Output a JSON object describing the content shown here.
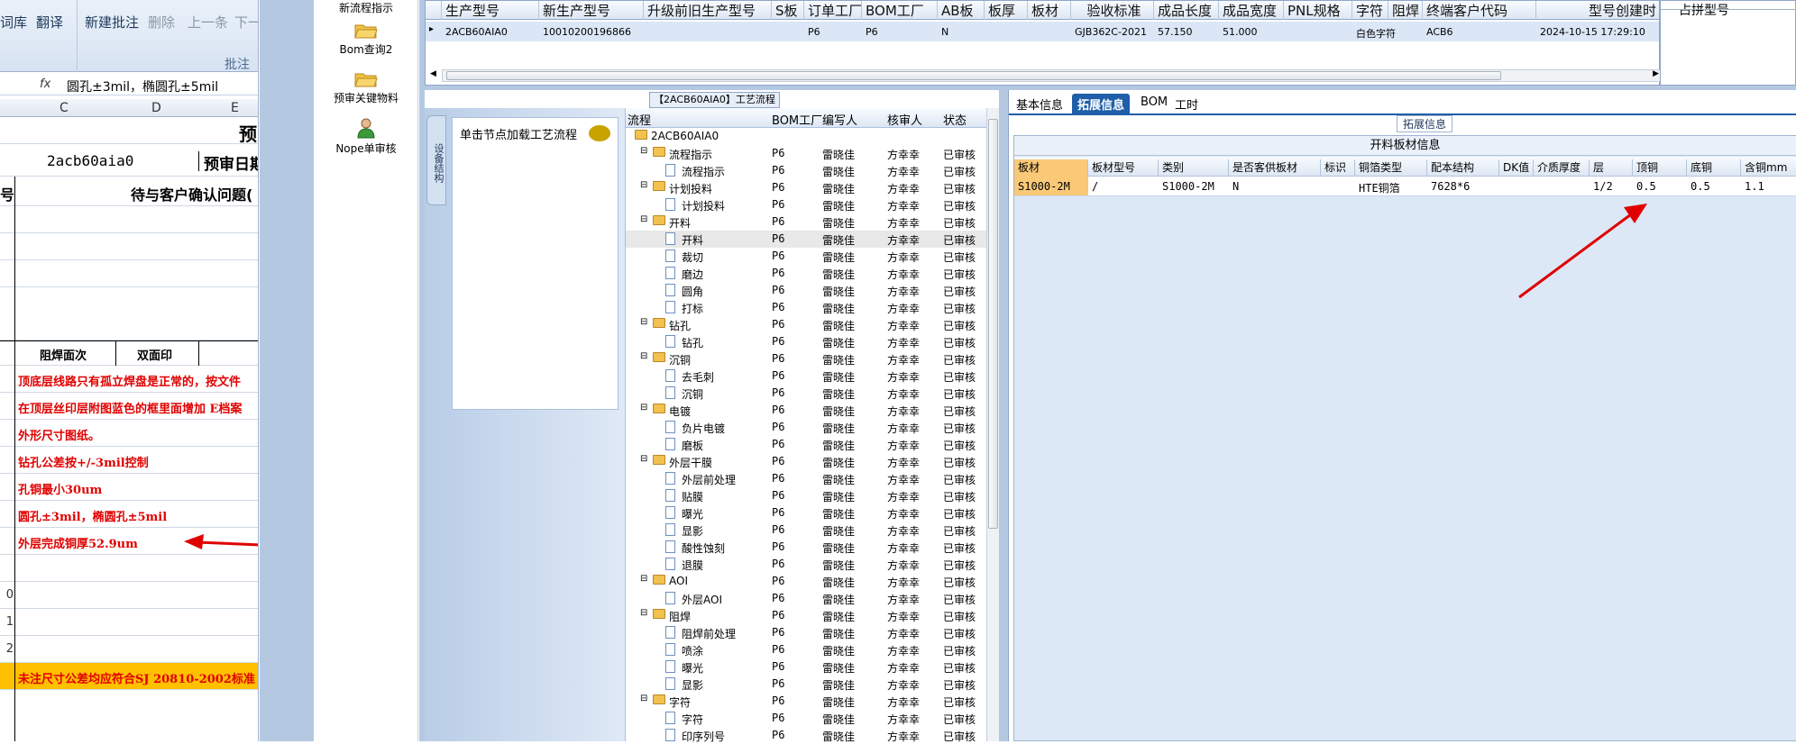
{
  "excel": {
    "ribbon": {
      "partial_label": "词库",
      "translate": "翻译",
      "new_annotation": "新建批注",
      "delete": "删除",
      "prev": "上一条",
      "next": "下一",
      "group_title": "批注"
    },
    "formula_value": "圆孔±3mil，椭圆孔±5mil",
    "columns": [
      "C",
      "D",
      "E"
    ],
    "partial_title_char": "预",
    "model_value": "2acb60aia0",
    "review_date_label": "预审日期",
    "pending_header": "待与客户确认问题(",
    "partial_num_header": "号",
    "solder_mask_side": "阻焊面次",
    "double_print": "双面印",
    "rows": [
      {
        "num": "",
        "text": "顶底层线路只有孤立焊盘是正常的，按文件"
      },
      {
        "num": "",
        "text": "在顶层丝印层附图蓝色的框里面增加 E档案"
      },
      {
        "num": "",
        "text": "外形尺寸图纸。"
      },
      {
        "num": "",
        "text": "钻孔公差按+/-3mil控制"
      },
      {
        "num": "",
        "text": "孔铜最小30um"
      },
      {
        "num": "",
        "text": "圆孔±3mil，椭圆孔±5mil"
      },
      {
        "num": "",
        "text": "外层完成铜厚52.9um"
      },
      {
        "num": "",
        "text": ""
      },
      {
        "num": "0",
        "text": ""
      },
      {
        "num": "1",
        "text": ""
      },
      {
        "num": "2",
        "text": ""
      },
      {
        "num": "",
        "text": "未注尺寸公差均应符合SJ 20810-2002标准"
      }
    ]
  },
  "launcher": {
    "items": [
      {
        "label": "新流程指示"
      },
      {
        "label": "Bom查询2"
      },
      {
        "label": "预审关键物料"
      },
      {
        "label": "Nope单审核"
      }
    ]
  },
  "top_grid": {
    "headers": [
      "生产型号",
      "新生产型号",
      "升级前旧生产型号",
      "S板",
      "订单工厂",
      "BOM工厂",
      "AB板",
      "板厚",
      "板材",
      "验收标准",
      "成品长度",
      "成品宽度",
      "PNL规格",
      "字符",
      "阻焊",
      "终端客户代码",
      "型号创建时"
    ],
    "row": [
      "2ACB60AIA0",
      "10010200196866",
      "",
      "",
      "P6",
      "P6",
      "N",
      "",
      "",
      "GJB362C-2021",
      "57.150",
      "51.000",
      "",
      "白色字符",
      "",
      "ACB6",
      "2024-10-15 17:29:10"
    ],
    "right_header": "占拼型号"
  },
  "process": {
    "title": "【2ACB60AIA0】工艺流程",
    "vtab_label": "设备结构",
    "hint": "单击节点加载工艺流程",
    "headers": [
      "流程",
      "BOM工厂",
      "编写人",
      "核审人",
      "状态"
    ],
    "nodes": [
      {
        "level": 0,
        "name": "2ACB60AIA0",
        "factory": "",
        "writer": "",
        "reviewer": "",
        "status": ""
      },
      {
        "level": 1,
        "name": "流程指示",
        "factory": "P6",
        "writer": "雷晓佳",
        "reviewer": "方幸幸",
        "status": "已审核"
      },
      {
        "level": 2,
        "name": "流程指示",
        "factory": "P6",
        "writer": "雷晓佳",
        "reviewer": "方幸幸",
        "status": "已审核"
      },
      {
        "level": 1,
        "name": "计划投料",
        "factory": "P6",
        "writer": "雷晓佳",
        "reviewer": "方幸幸",
        "status": "已审核"
      },
      {
        "level": 2,
        "name": "计划投料",
        "factory": "P6",
        "writer": "雷晓佳",
        "reviewer": "方幸幸",
        "status": "已审核"
      },
      {
        "level": 1,
        "name": "开料",
        "factory": "P6",
        "writer": "雷晓佳",
        "reviewer": "方幸幸",
        "status": "已审核"
      },
      {
        "level": 2,
        "name": "开料",
        "factory": "P6",
        "writer": "雷晓佳",
        "reviewer": "方幸幸",
        "status": "已审核"
      },
      {
        "level": 2,
        "name": "裁切",
        "factory": "P6",
        "writer": "雷晓佳",
        "reviewer": "方幸幸",
        "status": "已审核"
      },
      {
        "level": 2,
        "name": "磨边",
        "factory": "P6",
        "writer": "雷晓佳",
        "reviewer": "方幸幸",
        "status": "已审核"
      },
      {
        "level": 2,
        "name": "圆角",
        "factory": "P6",
        "writer": "雷晓佳",
        "reviewer": "方幸幸",
        "status": "已审核"
      },
      {
        "level": 2,
        "name": "打标",
        "factory": "P6",
        "writer": "雷晓佳",
        "reviewer": "方幸幸",
        "status": "已审核"
      },
      {
        "level": 1,
        "name": "钻孔",
        "factory": "P6",
        "writer": "雷晓佳",
        "reviewer": "方幸幸",
        "status": "已审核"
      },
      {
        "level": 2,
        "name": "钻孔",
        "factory": "P6",
        "writer": "雷晓佳",
        "reviewer": "方幸幸",
        "status": "已审核"
      },
      {
        "level": 1,
        "name": "沉铜",
        "factory": "P6",
        "writer": "雷晓佳",
        "reviewer": "方幸幸",
        "status": "已审核"
      },
      {
        "level": 2,
        "name": "去毛刺",
        "factory": "P6",
        "writer": "雷晓佳",
        "reviewer": "方幸幸",
        "status": "已审核"
      },
      {
        "level": 2,
        "name": "沉铜",
        "factory": "P6",
        "writer": "雷晓佳",
        "reviewer": "方幸幸",
        "status": "已审核"
      },
      {
        "level": 1,
        "name": "电镀",
        "factory": "P6",
        "writer": "雷晓佳",
        "reviewer": "方幸幸",
        "status": "已审核"
      },
      {
        "level": 2,
        "name": "负片电镀",
        "factory": "P6",
        "writer": "雷晓佳",
        "reviewer": "方幸幸",
        "status": "已审核"
      },
      {
        "level": 2,
        "name": "磨板",
        "factory": "P6",
        "writer": "雷晓佳",
        "reviewer": "方幸幸",
        "status": "已审核"
      },
      {
        "level": 1,
        "name": "外层干膜",
        "factory": "P6",
        "writer": "雷晓佳",
        "reviewer": "方幸幸",
        "status": "已审核"
      },
      {
        "level": 2,
        "name": "外层前处理",
        "factory": "P6",
        "writer": "雷晓佳",
        "reviewer": "方幸幸",
        "status": "已审核"
      },
      {
        "level": 2,
        "name": "贴膜",
        "factory": "P6",
        "writer": "雷晓佳",
        "reviewer": "方幸幸",
        "status": "已审核"
      },
      {
        "level": 2,
        "name": "曝光",
        "factory": "P6",
        "writer": "雷晓佳",
        "reviewer": "方幸幸",
        "status": "已审核"
      },
      {
        "level": 2,
        "name": "显影",
        "factory": "P6",
        "writer": "雷晓佳",
        "reviewer": "方幸幸",
        "status": "已审核"
      },
      {
        "level": 2,
        "name": "酸性蚀刻",
        "factory": "P6",
        "writer": "雷晓佳",
        "reviewer": "方幸幸",
        "status": "已审核"
      },
      {
        "level": 2,
        "name": "退膜",
        "factory": "P6",
        "writer": "雷晓佳",
        "reviewer": "方幸幸",
        "status": "已审核"
      },
      {
        "level": 1,
        "name": "AOI",
        "factory": "P6",
        "writer": "雷晓佳",
        "reviewer": "方幸幸",
        "status": "已审核"
      },
      {
        "level": 2,
        "name": "外层AOI",
        "factory": "P6",
        "writer": "雷晓佳",
        "reviewer": "方幸幸",
        "status": "已审核"
      },
      {
        "level": 1,
        "name": "阻焊",
        "factory": "P6",
        "writer": "雷晓佳",
        "reviewer": "方幸幸",
        "status": "已审核"
      },
      {
        "level": 2,
        "name": "阻焊前处理",
        "factory": "P6",
        "writer": "雷晓佳",
        "reviewer": "方幸幸",
        "status": "已审核"
      },
      {
        "level": 2,
        "name": "喷涂",
        "factory": "P6",
        "writer": "雷晓佳",
        "reviewer": "方幸幸",
        "status": "已审核"
      },
      {
        "level": 2,
        "name": "曝光",
        "factory": "P6",
        "writer": "雷晓佳",
        "reviewer": "方幸幸",
        "status": "已审核"
      },
      {
        "level": 2,
        "name": "显影",
        "factory": "P6",
        "writer": "雷晓佳",
        "reviewer": "方幸幸",
        "status": "已审核"
      },
      {
        "level": 1,
        "name": "字符",
        "factory": "P6",
        "writer": "雷晓佳",
        "reviewer": "方幸幸",
        "status": "已审核"
      },
      {
        "level": 2,
        "name": "字符",
        "factory": "P6",
        "writer": "雷晓佳",
        "reviewer": "方幸幸",
        "status": "已审核"
      },
      {
        "level": 2,
        "name": "印序列号",
        "factory": "P6",
        "writer": "雷晓佳",
        "reviewer": "方幸幸",
        "status": "已审核"
      }
    ]
  },
  "info": {
    "tabs": [
      "基本信息",
      "拓展信息",
      "BOM",
      "工时"
    ],
    "active_tab": 1,
    "section_label": "拓展信息",
    "table_title": "开料板材信息",
    "headers": [
      "板材",
      "板材型号",
      "类别",
      "是否客供板材",
      "标识",
      "铜箔类型",
      "配本结构",
      "DK值",
      "介质厚度",
      "层",
      "顶铜",
      "底铜",
      "含铜mm"
    ],
    "row": [
      "S1000-2M",
      "/",
      "S1000-2M",
      "N",
      "",
      "HTE铜箔",
      "7628*6",
      "",
      "",
      "1/2",
      "0.5",
      "0.5",
      "1.1"
    ]
  },
  "colors": {
    "accent": "#1f5ea8",
    "annotation_arrow": "#e00000",
    "highlight_row": "#dbe7f6",
    "selected_cell": "#f9c978"
  }
}
